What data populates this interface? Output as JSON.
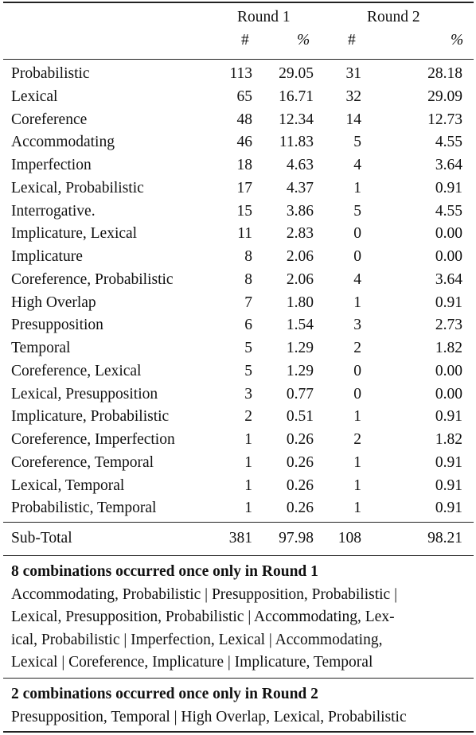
{
  "header": {
    "round1": "Round 1",
    "round2": "Round 2",
    "count_symbol": "#",
    "percent_symbol": "%"
  },
  "rows": [
    {
      "label": "Probabilistic",
      "r1_count": "113",
      "r1_pct": "29.05",
      "r2_count": "31",
      "r2_pct": "28.18"
    },
    {
      "label": "Lexical",
      "r1_count": "65",
      "r1_pct": "16.71",
      "r2_count": "32",
      "r2_pct": "29.09"
    },
    {
      "label": "Coreference",
      "r1_count": "48",
      "r1_pct": "12.34",
      "r2_count": "14",
      "r2_pct": "12.73"
    },
    {
      "label": "Accommodating",
      "r1_count": "46",
      "r1_pct": "11.83",
      "r2_count": "5",
      "r2_pct": "4.55"
    },
    {
      "label": "Imperfection",
      "r1_count": "18",
      "r1_pct": "4.63",
      "r2_count": "4",
      "r2_pct": "3.64"
    },
    {
      "label": "Lexical, Probabilistic",
      "r1_count": "17",
      "r1_pct": "4.37",
      "r2_count": "1",
      "r2_pct": "0.91"
    },
    {
      "label": "Interrogative.",
      "r1_count": "15",
      "r1_pct": "3.86",
      "r2_count": "5",
      "r2_pct": "4.55"
    },
    {
      "label": "Implicature, Lexical",
      "r1_count": "11",
      "r1_pct": "2.83",
      "r2_count": "0",
      "r2_pct": "0.00"
    },
    {
      "label": "Implicature",
      "r1_count": "8",
      "r1_pct": "2.06",
      "r2_count": "0",
      "r2_pct": "0.00"
    },
    {
      "label": "Coreference, Probabilistic",
      "r1_count": "8",
      "r1_pct": "2.06",
      "r2_count": "4",
      "r2_pct": "3.64"
    },
    {
      "label": "High Overlap",
      "r1_count": "7",
      "r1_pct": "1.80",
      "r2_count": "1",
      "r2_pct": "0.91"
    },
    {
      "label": "Presupposition",
      "r1_count": "6",
      "r1_pct": "1.54",
      "r2_count": "3",
      "r2_pct": "2.73"
    },
    {
      "label": "Temporal",
      "r1_count": "5",
      "r1_pct": "1.29",
      "r2_count": "2",
      "r2_pct": "1.82"
    },
    {
      "label": "Coreference, Lexical",
      "r1_count": "5",
      "r1_pct": "1.29",
      "r2_count": "0",
      "r2_pct": "0.00"
    },
    {
      "label": "Lexical, Presupposition",
      "r1_count": "3",
      "r1_pct": "0.77",
      "r2_count": "0",
      "r2_pct": "0.00"
    },
    {
      "label": "Implicature, Probabilistic",
      "r1_count": "2",
      "r1_pct": "0.51",
      "r2_count": "1",
      "r2_pct": "0.91"
    },
    {
      "label": "Coreference, Imperfection",
      "r1_count": "1",
      "r1_pct": "0.26",
      "r2_count": "2",
      "r2_pct": "1.82"
    },
    {
      "label": "Coreference, Temporal",
      "r1_count": "1",
      "r1_pct": "0.26",
      "r2_count": "1",
      "r2_pct": "0.91"
    },
    {
      "label": "Lexical, Temporal",
      "r1_count": "1",
      "r1_pct": "0.26",
      "r2_count": "1",
      "r2_pct": "0.91"
    },
    {
      "label": "Probabilistic, Temporal",
      "r1_count": "1",
      "r1_pct": "0.26",
      "r2_count": "1",
      "r2_pct": "0.91"
    }
  ],
  "subtotal": {
    "label": "Sub-Total",
    "r1_count": "381",
    "r1_pct": "97.98",
    "r2_count": "108",
    "r2_pct": "98.21"
  },
  "notes": [
    {
      "title": "8 combinations occurred once only in Round 1",
      "lines": [
        "Accommodating, Probabilistic | Presupposition, Probabilistic |",
        "Lexical, Presupposition, Probabilistic | Accommodating, Lex-",
        "ical, Probabilistic | Imperfection, Lexical | Accommodating,",
        "Lexical | Coreference, Implicature | Implicature, Temporal"
      ]
    },
    {
      "title": "2 combinations occurred once only in Round 2",
      "lines": [
        "Presupposition, Temporal | High Overlap, Lexical, Probabilistic"
      ]
    }
  ]
}
